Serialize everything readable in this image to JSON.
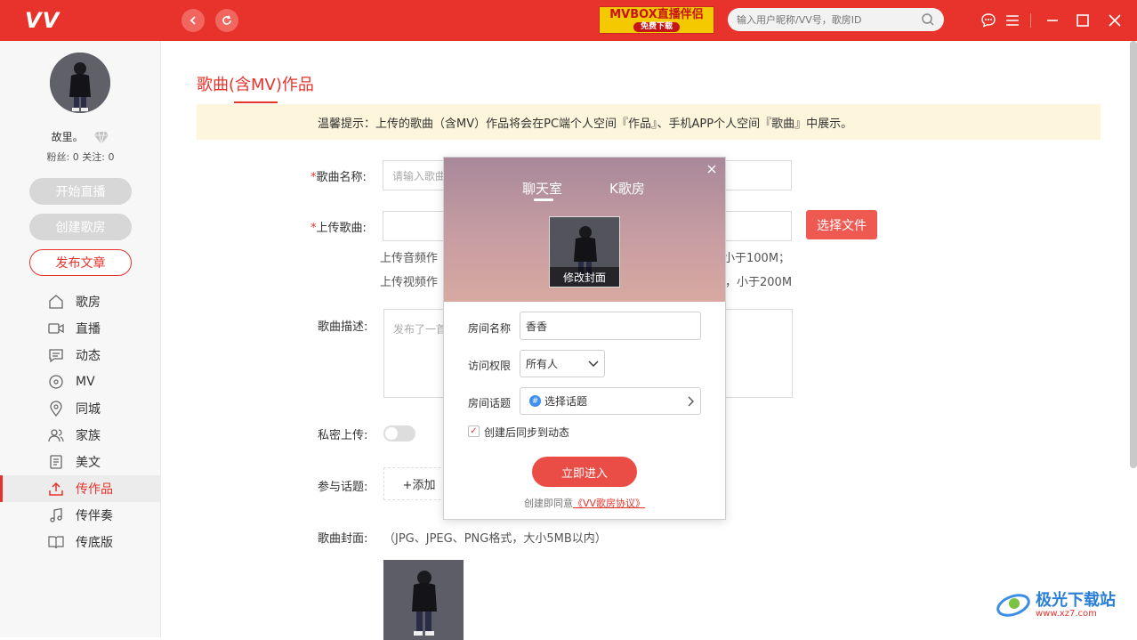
{
  "app": {
    "logo": "VV"
  },
  "titlebar": {
    "banner_main": "MVBOX直播伴侣",
    "banner_sub": "免费下载",
    "search_placeholder": "输入用户昵称/VV号，歌房ID"
  },
  "sidebar": {
    "username": "故里。",
    "stats": "粉丝: 0  关注: 0",
    "btn_live": "开始直播",
    "btn_room": "创建歌房",
    "btn_article": "发布文章",
    "menu": [
      {
        "label": "歌房",
        "icon": "home-icon"
      },
      {
        "label": "直播",
        "icon": "camera-icon"
      },
      {
        "label": "动态",
        "icon": "message-icon"
      },
      {
        "label": "MV",
        "icon": "disc-icon"
      },
      {
        "label": "同城",
        "icon": "location-icon"
      },
      {
        "label": "家族",
        "icon": "users-icon"
      },
      {
        "label": "美文",
        "icon": "document-icon"
      },
      {
        "label": "传作品",
        "icon": "upload-icon",
        "active": true
      },
      {
        "label": "传伴奏",
        "icon": "music-note-icon"
      },
      {
        "label": "传底版",
        "icon": "book-icon"
      }
    ]
  },
  "main": {
    "title": "歌曲(含MV)作品",
    "tip": "温馨提示：上传的歌曲（含MV）作品将会在PC端个人空间『作品』、手机APP个人空间『歌曲』中展示。",
    "song_name_label": "歌曲名称:",
    "song_name_placeholder": "请输入歌曲",
    "upload_label": "上传歌曲:",
    "select_file": "选择文件",
    "hint_audio_start": "上传音频作",
    "hint_audio_end": "小于100M；",
    "hint_video_start": "上传视频作",
    "hint_video_end": "，小于200M",
    "desc_label": "歌曲描述:",
    "desc_placeholder": "发布了一首",
    "private_label": "私密上传:",
    "topic_label": "参与话题:",
    "add_topic": "+添加",
    "cover_label": "歌曲封面:",
    "cover_hint": "（JPG、JPEG、PNG格式，大小5MB以内）"
  },
  "dialog": {
    "tab_chat": "聊天室",
    "tab_k": "K歌房",
    "edit_cover": "修改封面",
    "room_name_label": "房间名称",
    "room_name_value": "香香",
    "access_label": "访问权限",
    "access_value": "所有人",
    "topic_label": "房间话题",
    "topic_value": "选择话题",
    "sync_label": "创建后同步到动态",
    "enter_button": "立即进入",
    "agree_prefix": "创建即同意",
    "agree_link": "《VV歌房协议》"
  },
  "watermark": {
    "text": "极光下载站",
    "url": "www.xz7.com"
  },
  "colors": {
    "brand": "#e7332b",
    "tip_bg": "#fdf6dc"
  }
}
